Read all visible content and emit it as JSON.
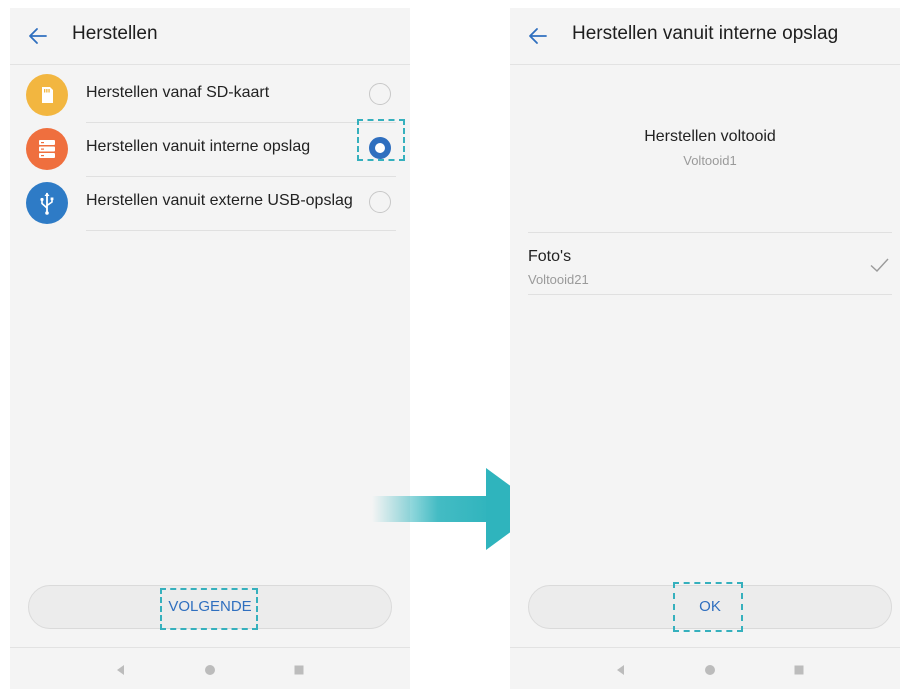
{
  "left_screen": {
    "title": "Herstellen",
    "options": [
      {
        "label": "Herstellen vanaf SD-kaart",
        "icon": "sd-card-icon",
        "color": "#f2b640",
        "selected": false
      },
      {
        "label": "Herstellen vanuit interne opslag",
        "icon": "storage-icon",
        "color": "#ef6f3e",
        "selected": true
      },
      {
        "label": "Herstellen vanuit externe USB-opslag",
        "icon": "usb-icon",
        "color": "#2e7bc6",
        "selected": false
      }
    ],
    "next_button": "VOLGENDE"
  },
  "right_screen": {
    "title": "Herstellen vanuit interne opslag",
    "status_title": "Herstellen voltooid",
    "status_sub": "Voltooid1",
    "items": [
      {
        "title": "Foto's",
        "sub": "Voltooid21",
        "checked": true
      }
    ],
    "ok_button": "OK"
  },
  "colors": {
    "accent": "#2f6fbf",
    "highlight": "#35b0bd",
    "arrow": "#2fb4bd"
  }
}
